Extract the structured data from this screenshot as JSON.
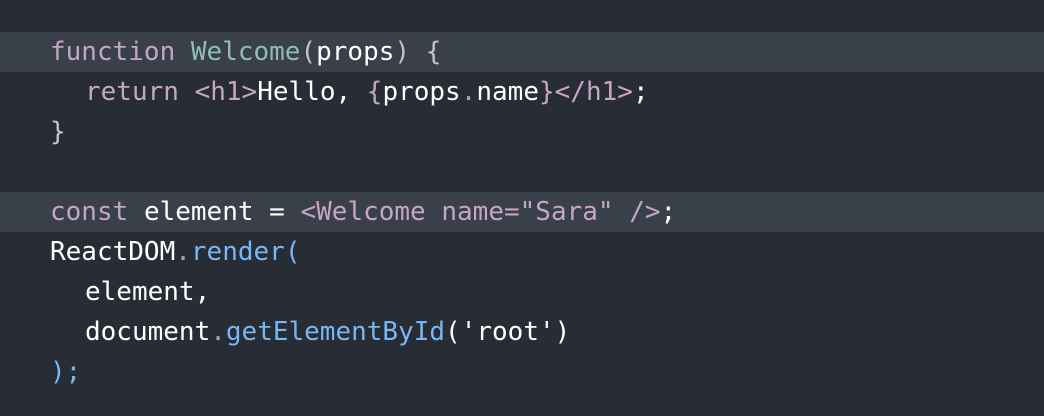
{
  "colors": {
    "background": "#282c34",
    "highlight": "#3a4049",
    "keyword": "#c5a5c5",
    "function_name": "#8fbcbb",
    "method": "#79b6f2",
    "plain": "#ffffff",
    "punctuation": "#c4c4c4"
  },
  "code": {
    "line1": {
      "keyword": "function",
      "name": "Welcome",
      "open_paren": "(",
      "param": "props",
      "close_paren": ")",
      "brace": "{"
    },
    "line2": {
      "keyword": "return",
      "tag_open": "<h1>",
      "text": "Hello, ",
      "expr_open": "{",
      "expr": "props",
      "dot": ".",
      "prop": "name",
      "expr_close": "}",
      "tag_close": "</h1>",
      "semi": ";"
    },
    "line3": {
      "brace": "}"
    },
    "line5": {
      "keyword": "const",
      "var": "element",
      "eq": "=",
      "tag_open": "<Welcome",
      "attr": "name",
      "attr_eq": "=",
      "attr_value": "\"Sara\"",
      "tag_close": "/>",
      "semi": ";"
    },
    "line6": {
      "object": "ReactDOM",
      "dot": ".",
      "method": "render",
      "paren": "("
    },
    "line7": {
      "arg": "element",
      "comma": ","
    },
    "line8": {
      "object": "document",
      "dot": ".",
      "method": "getElementById",
      "paren_open": "(",
      "arg": "'root'",
      "paren_close": ")"
    },
    "line9": {
      "close": ");"
    }
  }
}
